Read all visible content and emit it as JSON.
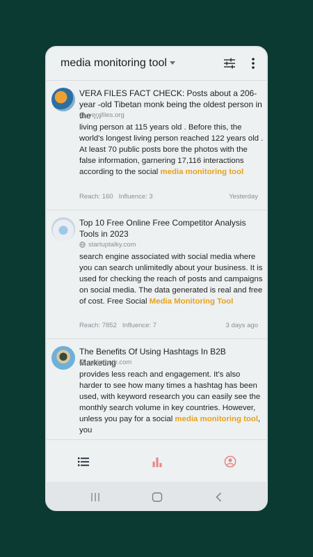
{
  "app": {
    "title": "media monitoring tool"
  },
  "colors": {
    "highlight": "#e6a21c",
    "accent_nav": "#e58a8a"
  },
  "icons": {
    "filter": "tune-icon",
    "menu": "more-vert-icon",
    "source": "globe-icon",
    "nav": [
      "list-icon",
      "bar-chart-icon",
      "account-icon"
    ],
    "system": [
      "recent-apps-icon",
      "home-icon",
      "back-icon"
    ]
  },
  "cards": [
    {
      "title": "VERA FILES FACT CHECK: Posts about a 206-year -old Tibetan monk being the oldest person in the …",
      "source": "verafiles.org",
      "body_pre": "living person at 115 years old . Before this, the world's longest living person reached 122 years old . At least 70 public posts bore the photos with the false information, garnering 17,116 interactions according to the social ",
      "body_hl": "media monitoring tool",
      "body_post": "",
      "reach": "Reach: 160",
      "influence": "Influence: 3",
      "time": "Yesterday"
    },
    {
      "title": "Top 10 Free Online Free Competitor Analysis Tools in 2023",
      "source": "startuptalky.com",
      "body_pre": "search engine associated with social media where you can search unlimitedly about your business. It is used for checking the reach of posts and campaigns on social media. The data generated is real and free of cost. Free Social ",
      "body_hl": "Media Monitoring Tool",
      "body_post": "",
      "reach": "Reach: 7852",
      "influence": "Influence: 7",
      "time": "3 days ago"
    },
    {
      "title": "The Benefits Of Using Hashtags In B2B Marketing",
      "source": "radialpath.com",
      "body_pre": "provides less reach and engagement. It's also harder to see how many times a hashtag has been used, with keyword research you can easily see the monthly search volume in key countries. However, unless you pay for a social ",
      "body_hl": "media monitoring tool",
      "body_post": ", you",
      "reach": "",
      "influence": "",
      "time": ""
    }
  ]
}
